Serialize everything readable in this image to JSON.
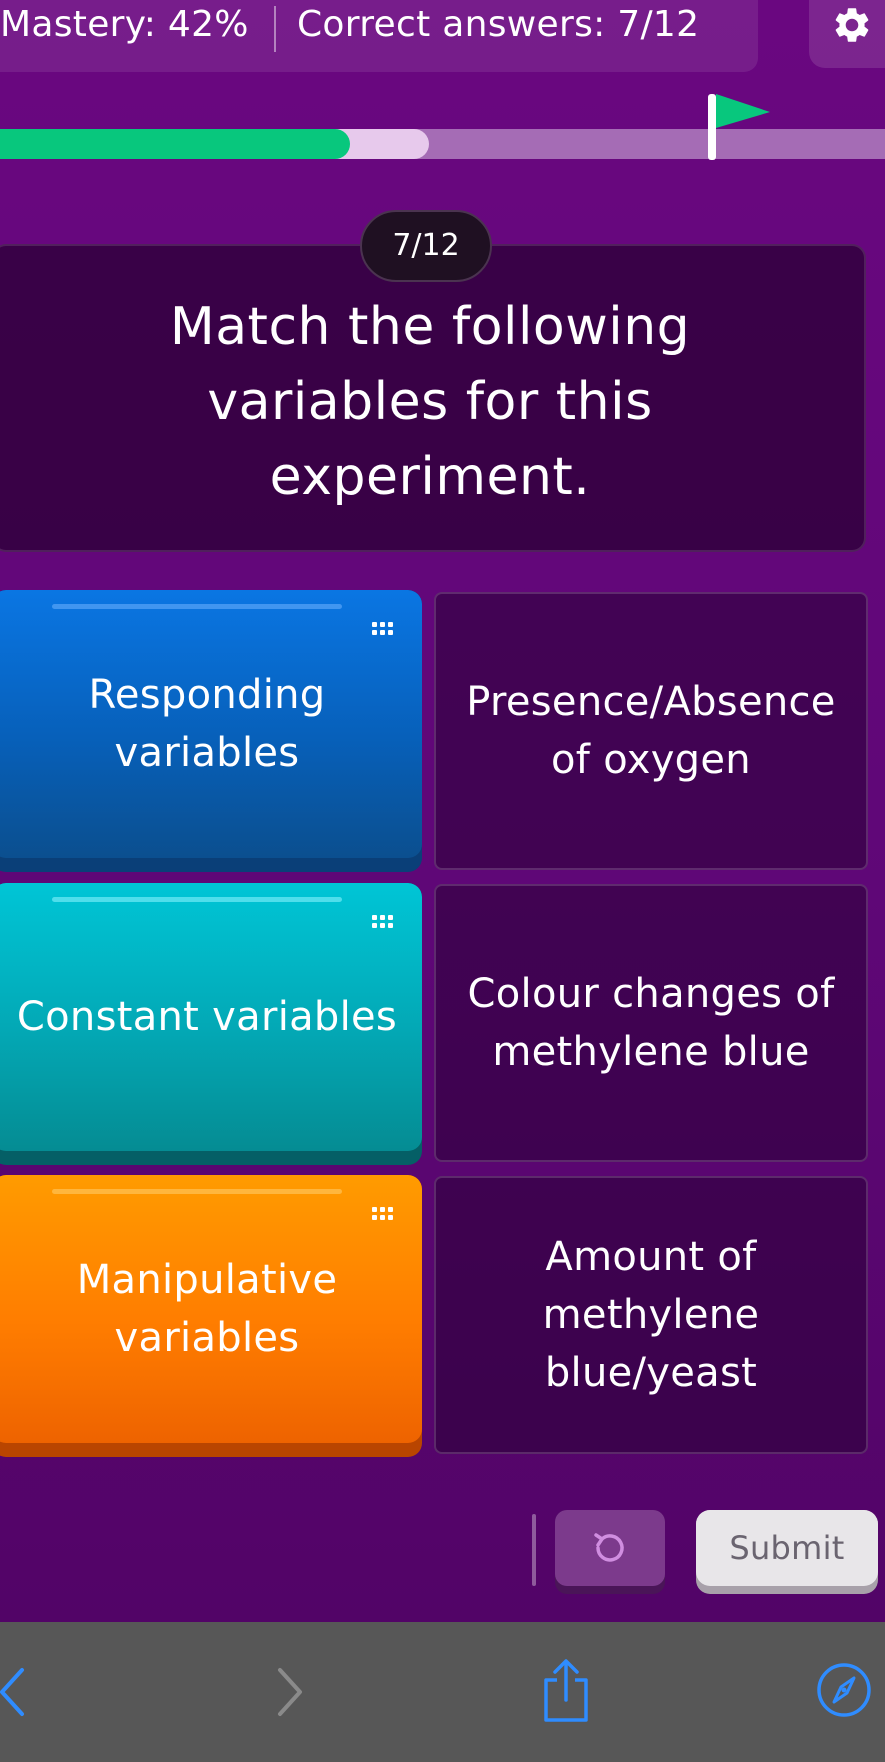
{
  "header": {
    "mastery_label": "Mastery: 42%",
    "mastery_percent": 42,
    "correct_label": "Correct answers: 7/12",
    "settings_icon": "gear-icon"
  },
  "progress": {
    "fill_fraction": 0.395,
    "buffer_fraction": 0.485,
    "fill_color": "#08c77d",
    "goal_icon": "flag-icon"
  },
  "question": {
    "counter": "7/12",
    "text": "Match the following variables for this experiment."
  },
  "items": [
    {
      "label": "Responding variables",
      "color": "#0a76e3"
    },
    {
      "label": "Constant variables",
      "color": "#00c5d6"
    },
    {
      "label": "Manipulative variables",
      "color": "#ff9b00"
    }
  ],
  "targets": [
    {
      "label": "Presence/Absence of oxygen"
    },
    {
      "label": "Colour changes of methylene blue"
    },
    {
      "label": "Amount of methylene blue/yeast"
    }
  ],
  "actions": {
    "undo_icon": "undo-icon",
    "submit_label": "Submit"
  },
  "browser": {
    "back_icon": "back-arrow-icon",
    "forward_icon": "forward-arrow-icon",
    "share_icon": "share-icon",
    "compass_icon": "compass-icon"
  }
}
